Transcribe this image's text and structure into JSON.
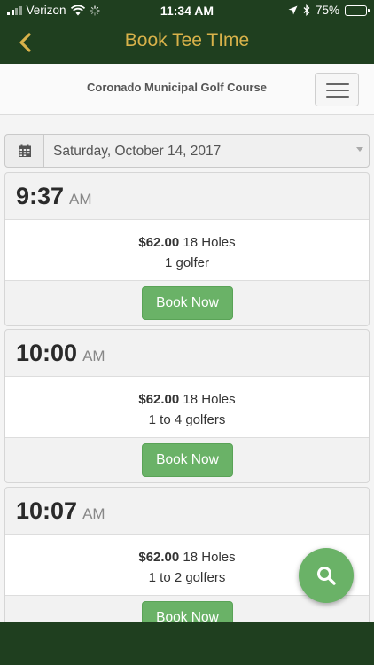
{
  "status_bar": {
    "carrier": "Verizon",
    "time": "11:34 AM",
    "battery": "75%",
    "battery_level": 0.75
  },
  "nav": {
    "title": "Book Tee TIme",
    "back_icon": "chevron-left-icon",
    "colors": {
      "bar": "#1f3f1f",
      "title": "#d8b24a"
    }
  },
  "header": {
    "course_name": "Coronado Municipal Golf Course",
    "menu_icon": "hamburger-icon"
  },
  "date_picker": {
    "icon": "calendar-icon",
    "value": "Saturday, October 14, 2017"
  },
  "tee_times": [
    {
      "time": "9:37",
      "ampm": "AM",
      "price": "$62.00",
      "holes": "18 Holes",
      "golfers": "1 golfer",
      "button": "Book Now"
    },
    {
      "time": "10:00",
      "ampm": "AM",
      "price": "$62.00",
      "holes": "18 Holes",
      "golfers": "1 to 4 golfers",
      "button": "Book Now"
    },
    {
      "time": "10:07",
      "ampm": "AM",
      "price": "$62.00",
      "holes": "18 Holes",
      "golfers": "1 to 2 golfers",
      "button": "Book Now"
    }
  ],
  "fab": {
    "icon": "search-icon",
    "color": "#6ab267"
  }
}
